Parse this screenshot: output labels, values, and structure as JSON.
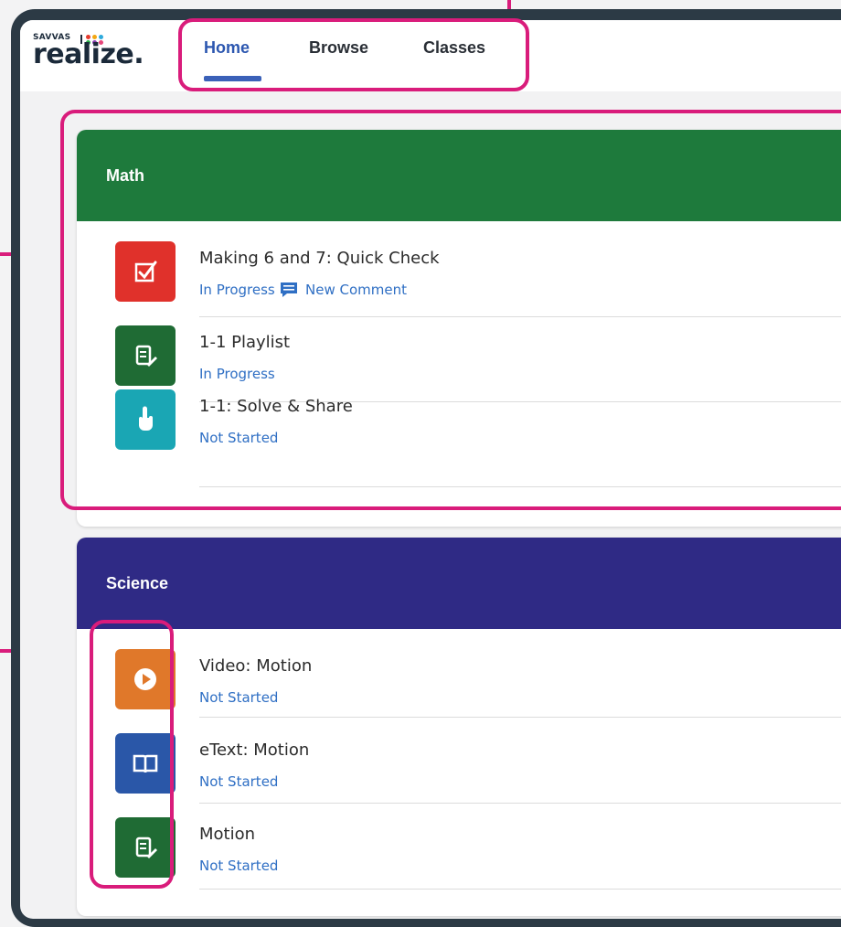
{
  "logo": {
    "small": "SAVVAS",
    "word": "realize."
  },
  "nav": {
    "tabs": [
      "Home",
      "Browse",
      "Classes"
    ],
    "active": "Home"
  },
  "colors": {
    "highlight": "#d91c7b",
    "math_header": "#1e7a3c",
    "science_header": "#2f2a85",
    "status_text": "#2f6fc4"
  },
  "math": {
    "title": "Math",
    "items": [
      {
        "title": "Making 6 and 7: Quick Check",
        "status": "In Progress",
        "comment": "New Comment",
        "icon": "checkbox-icon",
        "color": "#e0312b"
      },
      {
        "title": "1-1 Playlist",
        "status": "In Progress",
        "icon": "notepad-pencil-icon",
        "color": "#1f6b34"
      },
      {
        "title": "1-1: Solve & Share",
        "status": "Not Started",
        "icon": "pointer-hand-icon",
        "color": "#1aa6b4"
      }
    ]
  },
  "science": {
    "title": "Science",
    "items": [
      {
        "title": "Video: Motion",
        "status": "Not Started",
        "icon": "play-icon",
        "color": "#e0782a"
      },
      {
        "title": "eText: Motion",
        "status": "Not Started",
        "icon": "book-icon",
        "color": "#2a57a8"
      },
      {
        "title": "Motion",
        "status": "Not Started",
        "icon": "notepad-pencil-icon",
        "color": "#1f6b34"
      }
    ]
  }
}
